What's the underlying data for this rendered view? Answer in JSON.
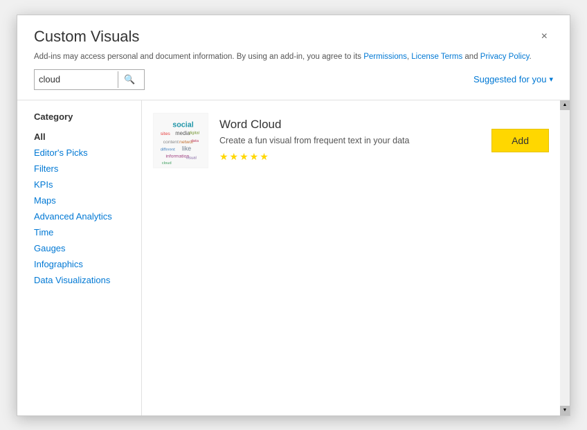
{
  "dialog": {
    "title": "Custom Visuals",
    "close_label": "×"
  },
  "disclaimer": {
    "text": "Add-ins may access personal and document information. By using an add-in, you agree to its Permissions, License Terms and Privacy Policy.",
    "links": [
      "Permissions",
      "License Terms",
      "Privacy Policy"
    ]
  },
  "search": {
    "value": "cloud",
    "placeholder": "cloud",
    "icon": "🔍"
  },
  "suggested": {
    "label": "Suggested for you",
    "chevron": "▾"
  },
  "sidebar": {
    "category_label": "Category",
    "items": [
      {
        "id": "all",
        "label": "All",
        "active": true
      },
      {
        "id": "editors-picks",
        "label": "Editor's Picks",
        "active": false
      },
      {
        "id": "filters",
        "label": "Filters",
        "active": false
      },
      {
        "id": "kpis",
        "label": "KPIs",
        "active": false
      },
      {
        "id": "maps",
        "label": "Maps",
        "active": false
      },
      {
        "id": "advanced-analytics",
        "label": "Advanced Analytics",
        "active": false
      },
      {
        "id": "time",
        "label": "Time",
        "active": false
      },
      {
        "id": "gauges",
        "label": "Gauges",
        "active": false
      },
      {
        "id": "infographics",
        "label": "Infographics",
        "active": false
      },
      {
        "id": "data-visualizations",
        "label": "Data Visualizations",
        "active": false
      }
    ]
  },
  "visuals": [
    {
      "name": "Word Cloud",
      "description": "Create a fun visual from frequent text in your data",
      "stars": 5,
      "add_label": "Add"
    }
  ],
  "scrollbar": {
    "up_arrow": "▲",
    "down_arrow": "▼"
  }
}
